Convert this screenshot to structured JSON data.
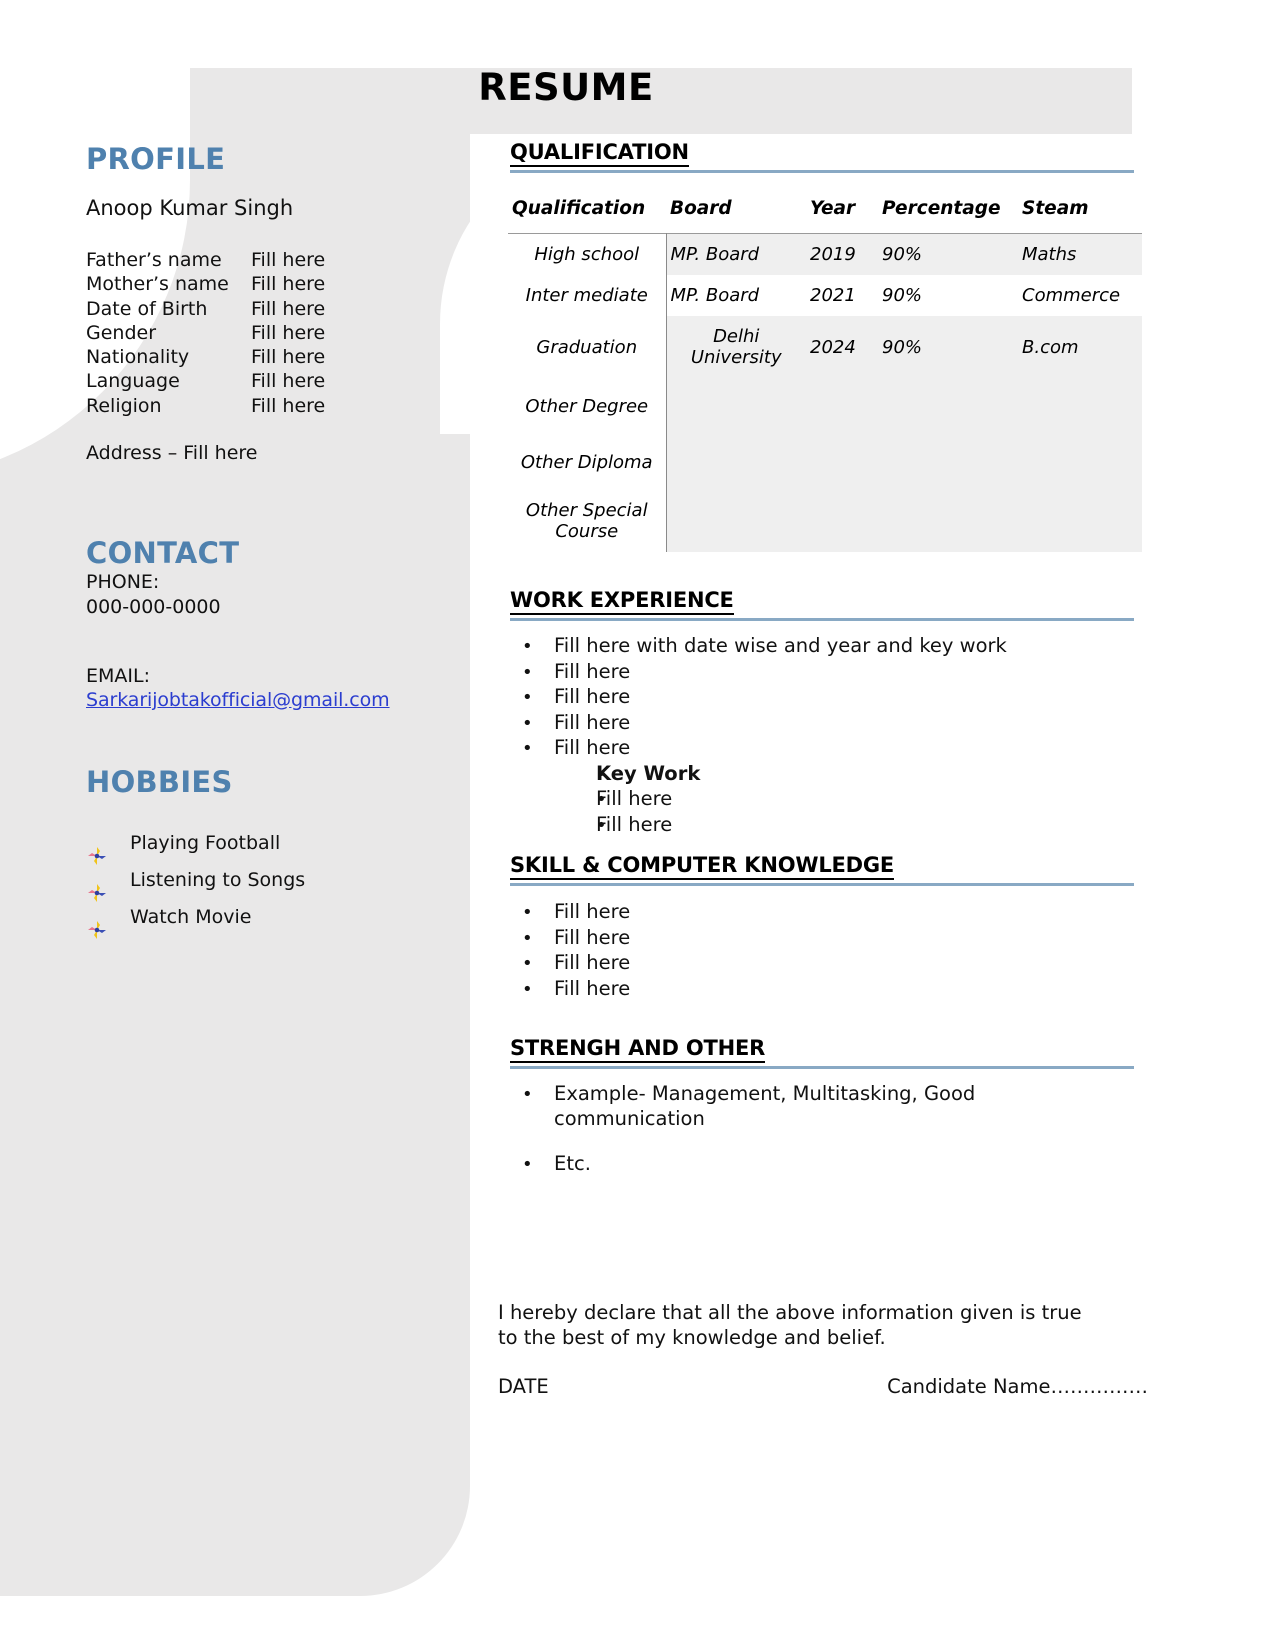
{
  "document": {
    "title": "RESUME"
  },
  "sidebar": {
    "profile": {
      "heading": "PROFILE",
      "name": "Anoop Kumar Singh",
      "fields": [
        {
          "label": "Father’s name",
          "value": "Fill here"
        },
        {
          "label": "Mother’s name",
          "value": "Fill here"
        },
        {
          "label": "Date of Birth",
          "value": "Fill here"
        },
        {
          "label": "Gender",
          "value": "Fill here"
        },
        {
          "label": "Nationality",
          "value": "Fill here"
        },
        {
          "label": "Language",
          "value": "Fill here"
        },
        {
          "label": "Religion",
          "value": "Fill here"
        }
      ],
      "address": "Address – Fill here"
    },
    "contact": {
      "heading": "CONTACT",
      "phone_label": "PHONE:",
      "phone_value": "000-000-0000",
      "email_label": "EMAIL:",
      "email_value": "Sarkarijobtakofficial@gmail.com"
    },
    "hobbies": {
      "heading": "HOBBIES",
      "items": [
        "Playing Football",
        "Listening to Songs",
        "Watch Movie"
      ]
    }
  },
  "main": {
    "qualification": {
      "heading": "QUALIFICATION",
      "columns": [
        "Qualification",
        "Board",
        "Year",
        "Percentage",
        "Steam"
      ],
      "rows": [
        {
          "qualification": "High school",
          "board": "MP. Board",
          "year": "2019",
          "percentage": "90%",
          "steam": "Maths"
        },
        {
          "qualification": "Inter mediate",
          "board": "MP. Board",
          "year": "2021",
          "percentage": "90%",
          "steam": "Commerce"
        },
        {
          "qualification": "Graduation",
          "board": "Delhi University",
          "year": "2024",
          "percentage": "90%",
          "steam": "B.com"
        },
        {
          "qualification": "Other Degree",
          "board": "",
          "year": "",
          "percentage": "",
          "steam": ""
        },
        {
          "qualification": "Other Diploma",
          "board": "",
          "year": "",
          "percentage": "",
          "steam": ""
        },
        {
          "qualification": "Other Special Course",
          "board": "",
          "year": "",
          "percentage": "",
          "steam": ""
        }
      ]
    },
    "work_experience": {
      "heading": "WORK EXPERIENCE",
      "items": [
        "Fill here with date wise and year and key work",
        "Fill here",
        "Fill here",
        "Fill here",
        "Fill here"
      ],
      "sub_items": [
        {
          "text": "Key Work",
          "bold": true
        },
        {
          "text": "Fill here",
          "bold": false
        },
        {
          "text": "Fill here",
          "bold": false
        }
      ]
    },
    "skills": {
      "heading": "SKILL & COMPUTER KNOWLEDGE",
      "items": [
        "Fill here",
        "Fill here",
        "Fill here",
        "Fill here"
      ]
    },
    "strength": {
      "heading": "STRENGH AND OTHER",
      "items": [
        "Example- Management, Multitasking, Good communication",
        "Etc."
      ]
    },
    "footer": {
      "declaration": "I hereby declare that all the above information given is true to the best of my knowledge and belief.",
      "date_label": "DATE",
      "candidate_label": "Candidate Name……………"
    }
  },
  "colors": {
    "accent_blue": "#4f81ae",
    "rule_blue": "#89a9c4",
    "sidebar_gray": "#e9e8e8",
    "link_blue": "#2b3dcf",
    "table_shade": "#efefef"
  }
}
